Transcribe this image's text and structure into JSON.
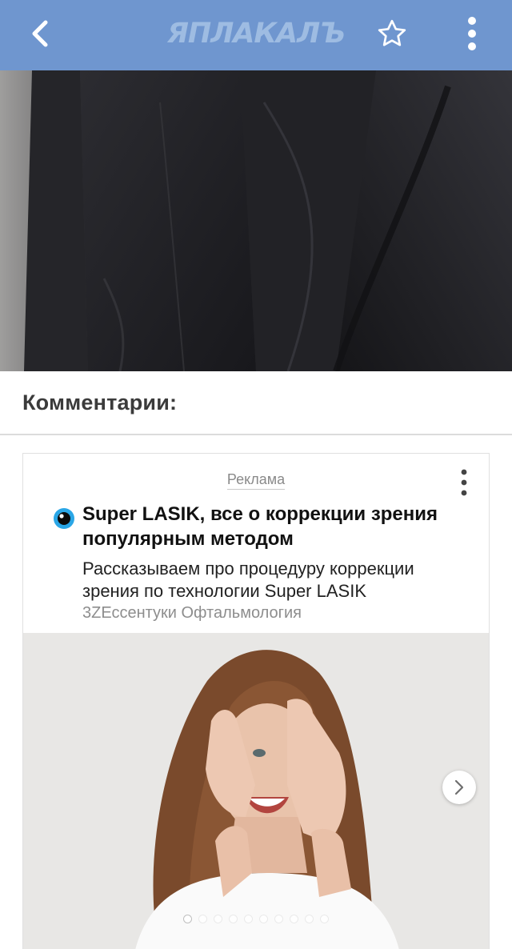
{
  "appbar": {
    "logo_text": "ЯПЛАКАЛЪ",
    "icons": {
      "back": "back-arrow-icon",
      "favorite": "star-icon",
      "menu": "more-vert-icon"
    },
    "colors": {
      "background": "#6f96cf",
      "logo": "#9ebce2"
    }
  },
  "comments": {
    "title": "Комментарии:"
  },
  "ad": {
    "label": "Реклама",
    "title": "Super LASIK, все о коррекции зрения популярным методом",
    "description": "Рассказываем про процедуру коррекции зрения по технологии Super LASIK",
    "domain": "3ZЕссентуки Офтальмология",
    "favicon": "eye-icon",
    "slides_count": 10,
    "active_slide": 1
  }
}
